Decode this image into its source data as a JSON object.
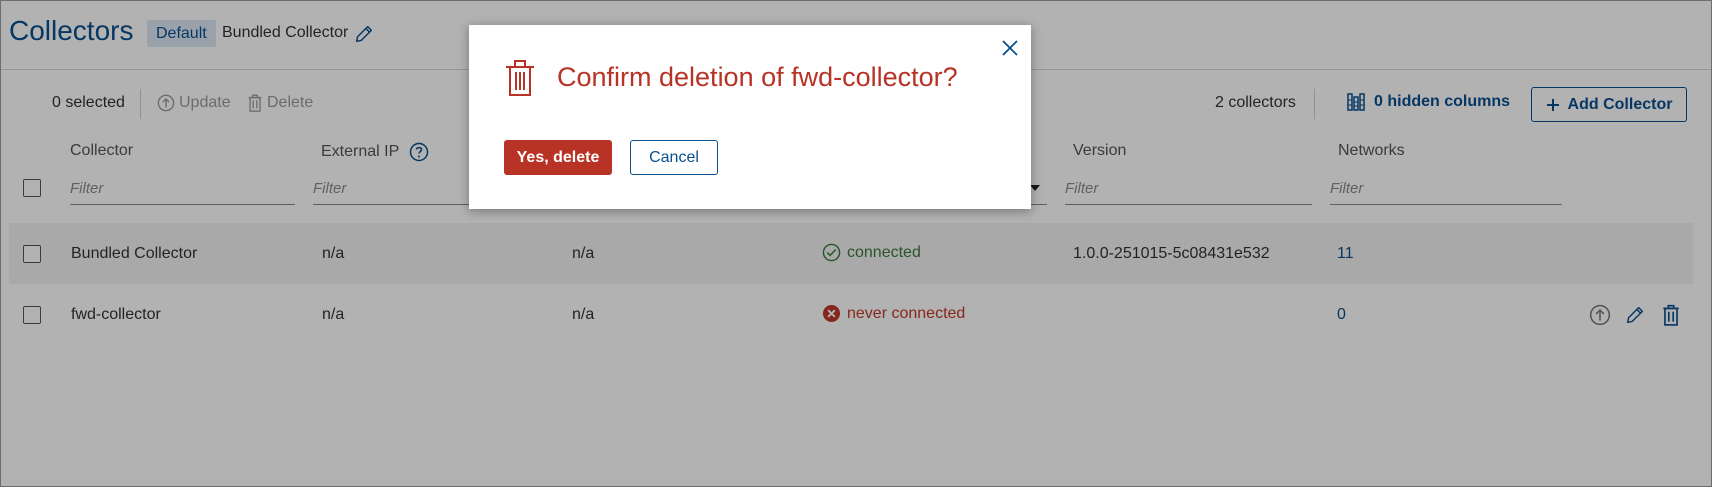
{
  "header": {
    "title": "Collectors",
    "badge": "Default",
    "collector_name": "Bundled Collector"
  },
  "toolbar": {
    "selected_count": "0 selected",
    "update_label": "Update",
    "delete_label": "Delete",
    "collectors_count": "2 collectors",
    "hidden_columns_label": "0 hidden columns",
    "add_label": "Add Collector"
  },
  "table": {
    "columns": {
      "collector": "Collector",
      "external_ip": "External IP",
      "version": "Version",
      "networks": "Networks"
    },
    "filter_placeholder": "Filter",
    "rows": [
      {
        "name": "Bundled Collector",
        "external_ip": "n/a",
        "internal_ip": "n/a",
        "status": "connected",
        "version": "1.0.0-251015-5c08431e532",
        "networks": "11"
      },
      {
        "name": "fwd-collector",
        "external_ip": "n/a",
        "internal_ip": "n/a",
        "status": "never connected",
        "version": "",
        "networks": "0"
      }
    ]
  },
  "dialog": {
    "title": "Confirm deletion of fwd-collector?",
    "confirm_label": "Yes, delete",
    "cancel_label": "Cancel"
  },
  "colors": {
    "primary": "#0a4f8f",
    "danger": "#b83225",
    "success": "#3c7a3c",
    "error": "#c0392b"
  }
}
